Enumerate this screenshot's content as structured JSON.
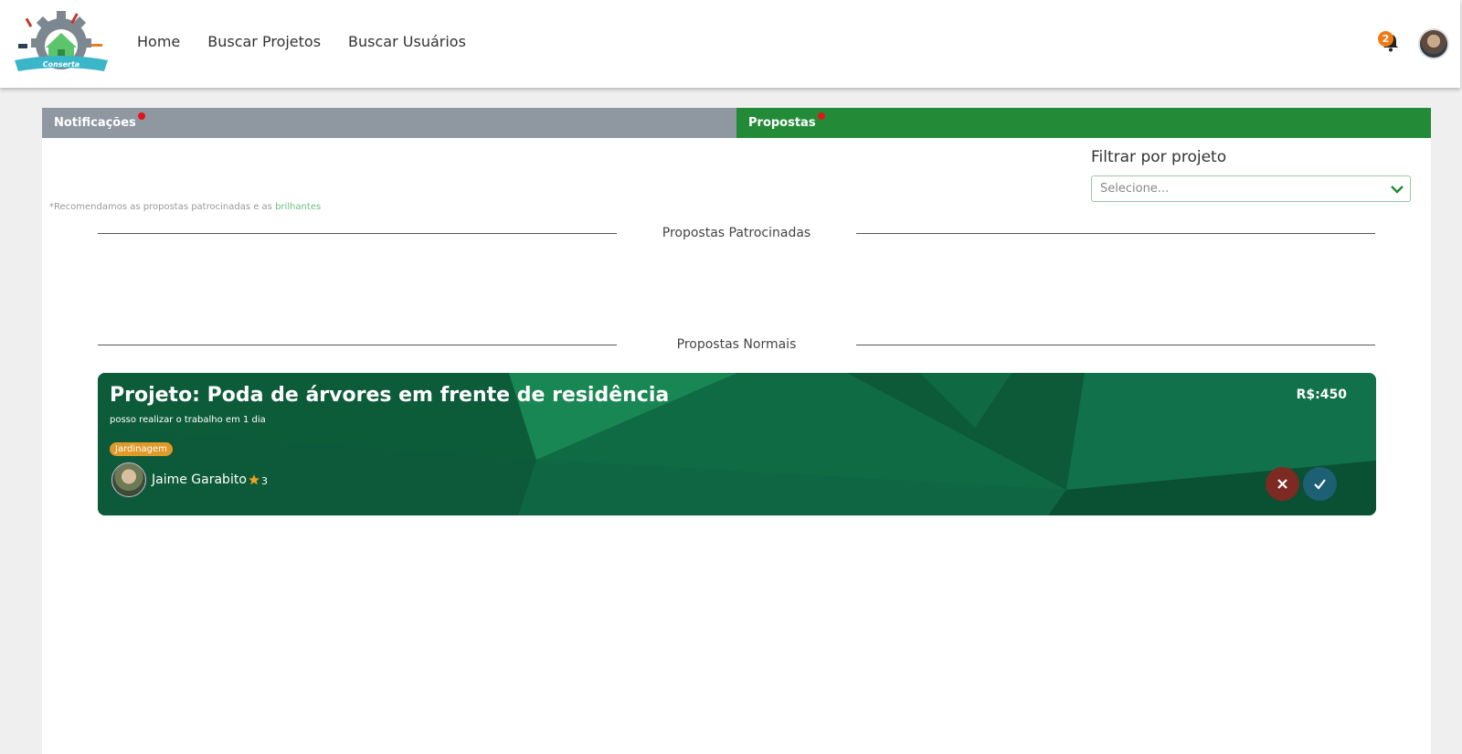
{
  "header": {
    "logo_text": "Conserta",
    "nav": [
      {
        "label": "Home"
      },
      {
        "label": "Buscar Projetos"
      },
      {
        "label": "Buscar Usuários"
      }
    ],
    "notification_count": "2",
    "icons": {
      "bell": "bell-icon",
      "avatar": "user-avatar"
    }
  },
  "tabs": [
    {
      "label": "Notificações",
      "active": false,
      "has_dot": true
    },
    {
      "label": "Propostas",
      "active": true,
      "has_dot": true
    }
  ],
  "filter": {
    "label": "Filtrar por projeto",
    "placeholder": "Selecione..."
  },
  "note": {
    "text": "*Recomendamos as propostas patrocinadas e as ",
    "highlight": "brilhantes"
  },
  "sections": {
    "sponsored": "Propostas Patrocinadas",
    "normal": "Propostas Normais"
  },
  "proposal": {
    "title": "Projeto: Poda de árvores em frente de residência",
    "description": "posso realizar o trabalho em 1 dia",
    "tag": "Jardinagem",
    "user_name": "Jaime Garabito",
    "rating": "3",
    "price": "R$:450"
  },
  "colors": {
    "active_tab": "#238b38",
    "inactive_tab": "#8f98a1",
    "card": "#0f6540",
    "badge": "#f07a18",
    "tag": "#e09a2a",
    "reject": "#7d2a22",
    "accept": "#1d5f73"
  }
}
